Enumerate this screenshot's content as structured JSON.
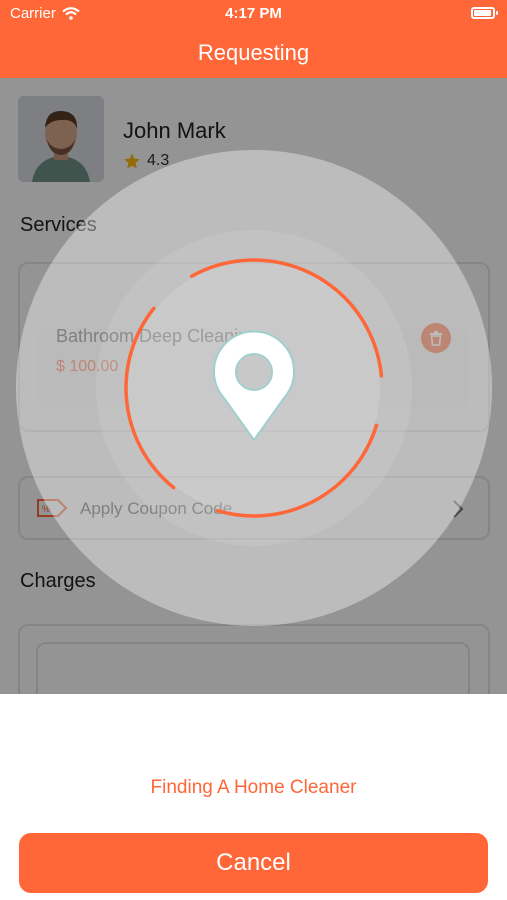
{
  "status_bar": {
    "carrier": "Carrier",
    "time": "4:17 PM"
  },
  "header": {
    "title": "Requesting"
  },
  "provider": {
    "name": "John Mark",
    "rating": "4.3"
  },
  "services": {
    "heading": "Services",
    "items": [
      {
        "name": "Bathroom Deep Cleaning",
        "price": "$ 100.00"
      }
    ]
  },
  "coupon": {
    "label": "Apply Coupon Code"
  },
  "charges": {
    "heading": "Charges"
  },
  "searching": {
    "message": "Finding A Home Cleaner"
  },
  "actions": {
    "cancel_label": "Cancel"
  },
  "colors": {
    "accent": "#FF6638",
    "overlay": "rgba(0,0,0,0.42)"
  },
  "icons": [
    "wifi-icon",
    "battery-icon",
    "star-icon",
    "trash-icon",
    "coupon-tag-icon",
    "chevron-right-icon",
    "location-pin-icon"
  ]
}
